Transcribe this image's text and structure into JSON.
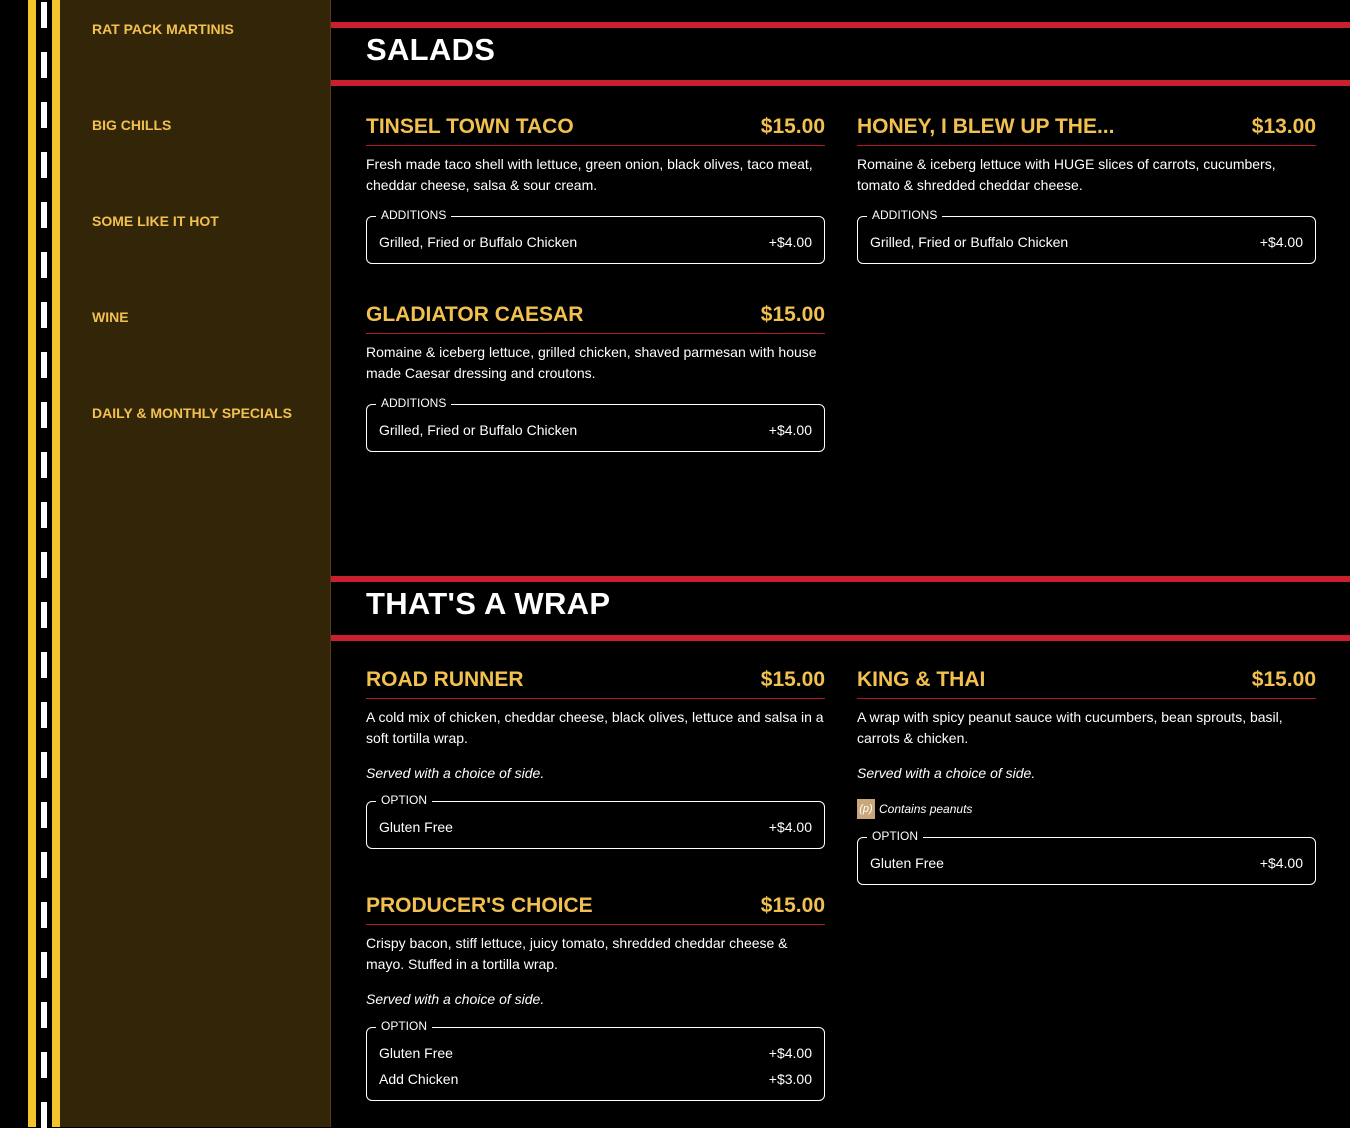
{
  "nav": {
    "items": [
      {
        "label": "RAT PACK MARTINIS"
      },
      {
        "label": "BIG CHILLS"
      },
      {
        "label": "SOME LIKE IT HOT"
      },
      {
        "label": "WINE"
      },
      {
        "label": "DAILY & MONTHLY SPECIALS"
      }
    ]
  },
  "salads": {
    "title": "SALADS",
    "items": [
      {
        "name": "TINSEL TOWN TACO",
        "price": "$15.00",
        "desc": "Fresh made taco shell with lettuce, green onion, black olives, taco meat, cheddar cheese, salsa & sour cream.",
        "box_label": "ADDITIONS",
        "rows": [
          {
            "label": "Grilled, Fried or Buffalo Chicken",
            "price": "+$4.00"
          }
        ]
      },
      {
        "name": "HONEY, I BLEW UP THE...",
        "price": "$13.00",
        "desc": "Romaine & iceberg lettuce with HUGE slices of carrots, cucumbers, tomato & shredded cheddar cheese.",
        "box_label": "ADDITIONS",
        "rows": [
          {
            "label": "Grilled, Fried or Buffalo Chicken",
            "price": "+$4.00"
          }
        ]
      },
      {
        "name": "GLADIATOR CAESAR",
        "price": "$15.00",
        "desc": "Romaine & iceberg lettuce, grilled chicken, shaved parmesan with house made Caesar dressing and croutons.",
        "box_label": "ADDITIONS",
        "rows": [
          {
            "label": "Grilled, Fried or Buffalo Chicken",
            "price": "+$4.00"
          }
        ]
      }
    ]
  },
  "wraps": {
    "title": "THAT'S A WRAP",
    "items": [
      {
        "name": "ROAD RUNNER",
        "price": "$15.00",
        "desc": "A cold mix of chicken, cheddar cheese, black olives, lettuce and salsa in a soft tortilla wrap.",
        "note": "Served with a choice of side.",
        "box_label": "OPTION",
        "rows": [
          {
            "label": "Gluten Free",
            "price": "+$4.00"
          }
        ]
      },
      {
        "name": "KING & THAI",
        "price": "$15.00",
        "desc": "A wrap with spicy peanut sauce with cucumbers, bean sprouts, basil, carrots & chicken.",
        "note": "Served with a choice of side.",
        "allergen_tag": "(p)",
        "allergen_text": "Contains peanuts",
        "box_label": "OPTION",
        "rows": [
          {
            "label": "Gluten Free",
            "price": "+$4.00"
          }
        ]
      },
      {
        "name": "PRODUCER'S CHOICE",
        "price": "$15.00",
        "desc": "Crispy bacon, stiff lettuce, juicy tomato, shredded cheddar cheese & mayo. Stuffed in a tortilla wrap.",
        "note": "Served with a choice of side.",
        "box_label": "OPTION",
        "rows": [
          {
            "label": "Gluten Free",
            "price": "+$4.00"
          },
          {
            "label": "Add Chicken",
            "price": "+$3.00"
          }
        ]
      }
    ]
  },
  "colors": {
    "accent_yellow": "#f2c04f",
    "divider_red": "#c8202f",
    "sidebar_bg": "#332608",
    "road_yellow": "#f5c32c"
  }
}
